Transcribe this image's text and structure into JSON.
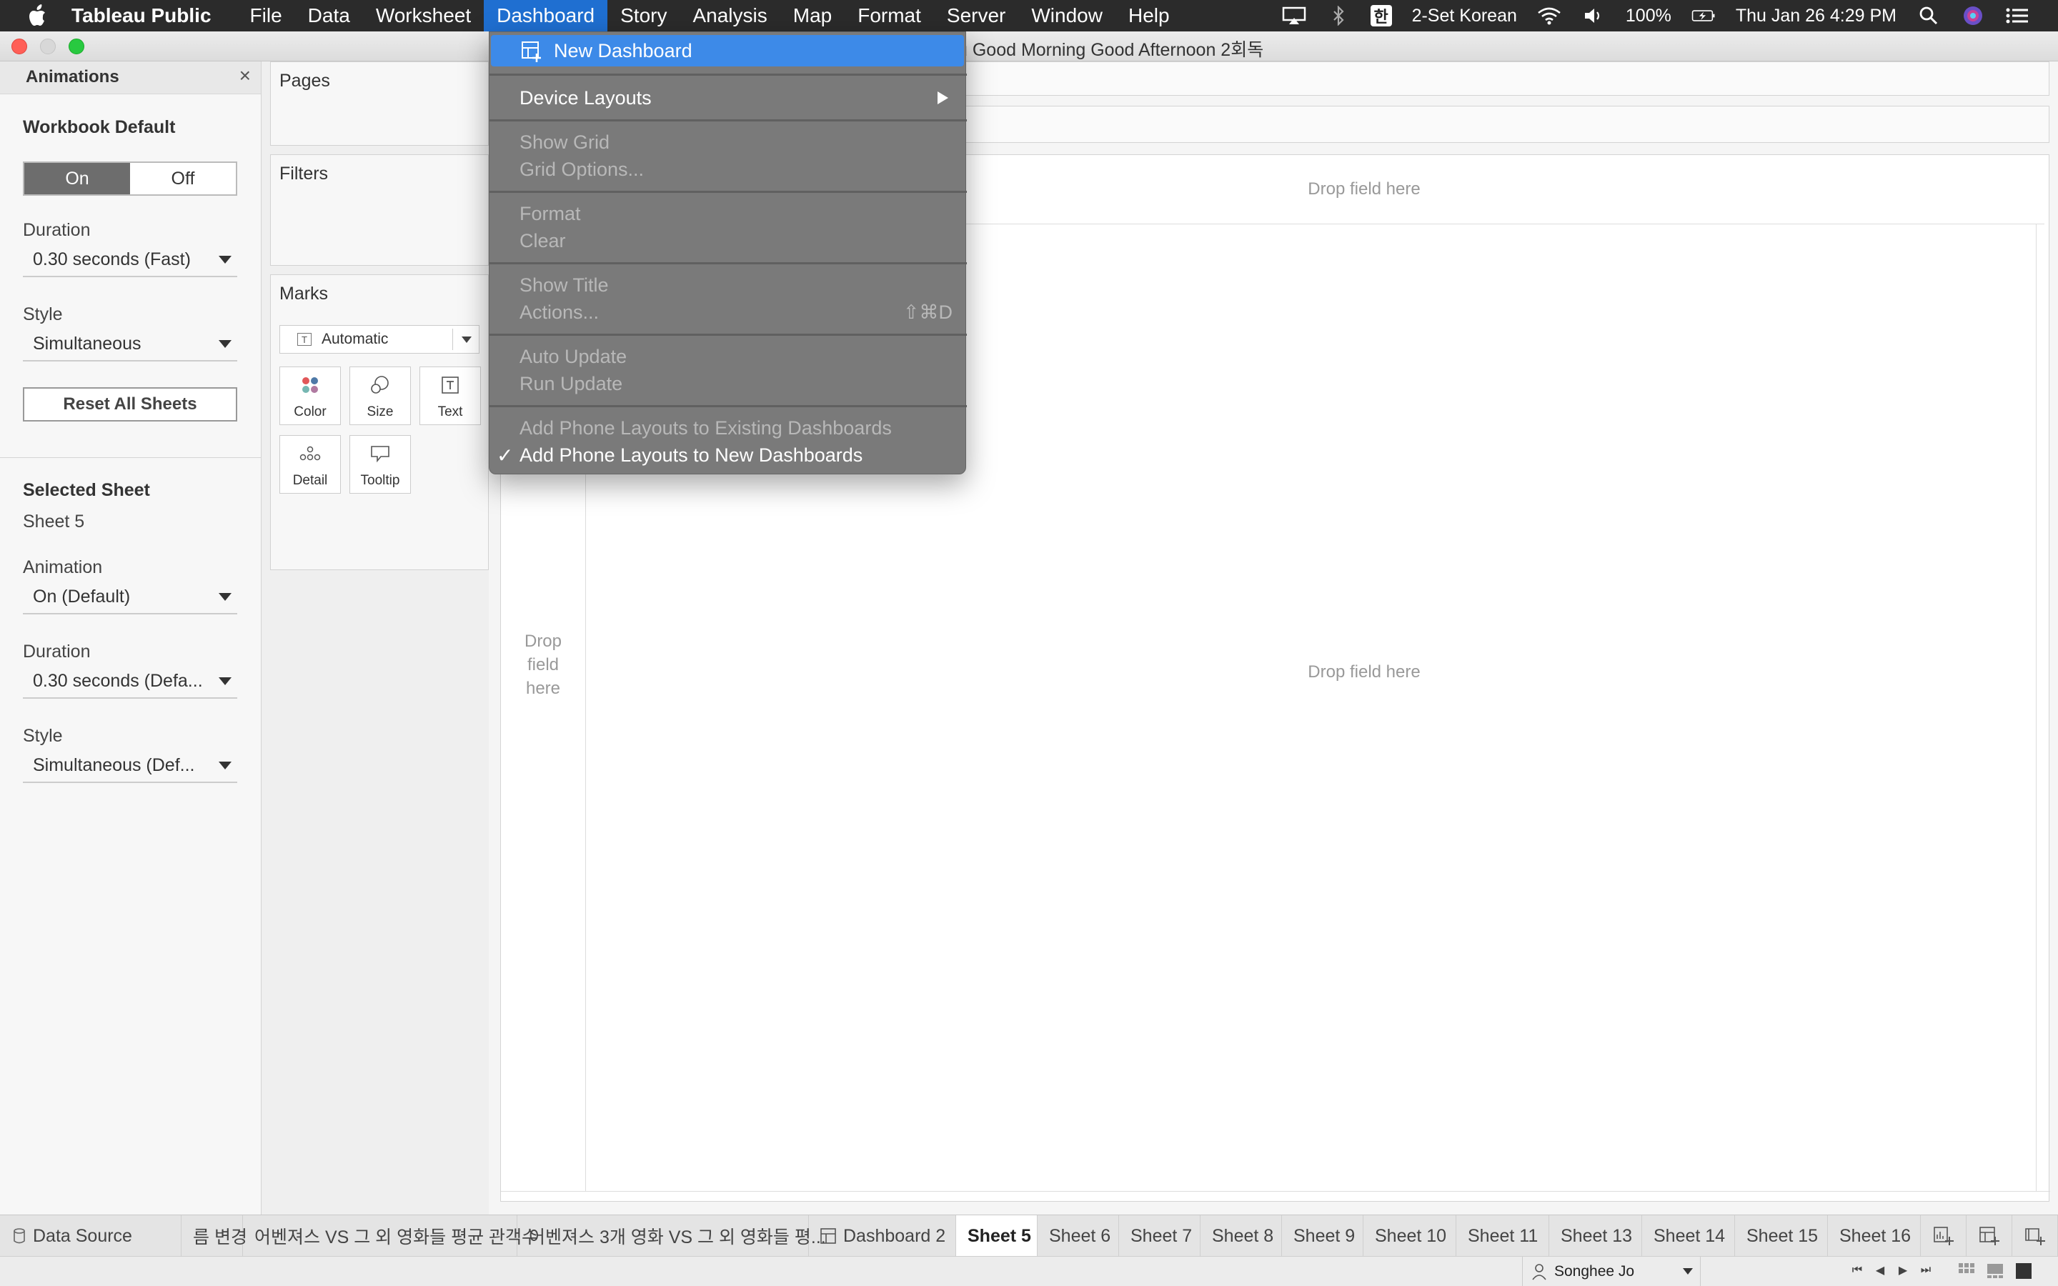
{
  "menubar": {
    "app_name": "Tableau Public",
    "items": [
      "File",
      "Data",
      "Worksheet",
      "Dashboard",
      "Story",
      "Analysis",
      "Map",
      "Format",
      "Server",
      "Window",
      "Help"
    ],
    "ime_badge": "한",
    "input_source": "2-Set Korean",
    "battery": "100%",
    "datetime": "Thu Jan 26  4:29 PM"
  },
  "window": {
    "title": "u Good Morning Good Afternoon 2회독"
  },
  "animations": {
    "title": "Animations",
    "close": "×",
    "workbook_default": "Workbook Default",
    "toggle_on": "On",
    "toggle_off": "Off",
    "duration_label": "Duration",
    "duration_value": "0.30 seconds (Fast)",
    "style_label": "Style",
    "style_value": "Simultaneous",
    "reset_button": "Reset All Sheets",
    "selected_sheet_title": "Selected Sheet",
    "selected_sheet_name": "Sheet 5",
    "animation_label": "Animation",
    "animation_value": "On (Default)",
    "sheet_duration_label": "Duration",
    "sheet_duration_value": "0.30 seconds (Defa...",
    "sheet_style_label": "Style",
    "sheet_style_value": "Simultaneous (Def..."
  },
  "cards": {
    "pages": "Pages",
    "filters": "Filters",
    "marks": "Marks",
    "mark_type": "Automatic",
    "mark_buttons": [
      "Color",
      "Size",
      "Text",
      "Detail",
      "Tooltip"
    ]
  },
  "canvas": {
    "drop_columns": "Drop field here",
    "drop_main": "Drop field here",
    "drop_rows_1": "Drop",
    "drop_rows_2": "field",
    "drop_rows_3": "here"
  },
  "dashboard_menu": {
    "new_dashboard": "New Dashboard",
    "device_layouts": "Device Layouts",
    "show_grid": "Show Grid",
    "grid_options": "Grid Options...",
    "format": "Format",
    "clear": "Clear",
    "show_title": "Show Title",
    "actions": "Actions...",
    "actions_shortcut": "⇧⌘D",
    "auto_update": "Auto Update",
    "run_update": "Run Update",
    "add_phone_existing": "Add Phone Layouts to Existing Dashboards",
    "add_phone_new": "Add Phone Layouts to New Dashboards",
    "check": "✓"
  },
  "tabs": {
    "data_source": "Data Source",
    "items": [
      "름 변경",
      "어벤져스 VS 그 외 영화들 평균 관객수",
      "어벤져스 3개 영화 VS 그 외 영화들 평...",
      "Dashboard 2",
      "Sheet 5",
      "Sheet 6",
      "Sheet 7",
      "Sheet 8",
      "Sheet 9",
      "Sheet 10",
      "Sheet 11",
      "Sheet 13",
      "Sheet 14",
      "Sheet 15",
      "Sheet 16"
    ],
    "active": "Sheet 5"
  },
  "statusbar": {
    "user": "Songhee Jo"
  },
  "colors": {
    "menu_highlight": "#3d8ae8",
    "menubar_active": "#1f6fd1",
    "toggle_on": "#6d6d6d"
  }
}
